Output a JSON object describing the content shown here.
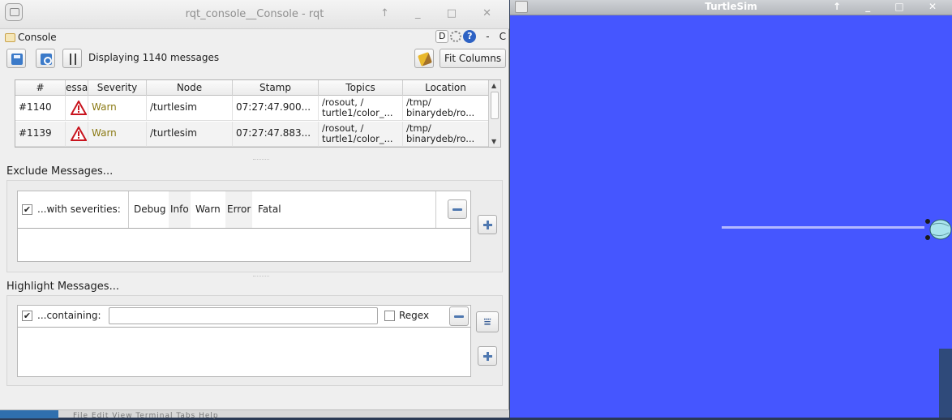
{
  "rqt": {
    "window_title": "rqt_console__Console - rqt",
    "title_buttons": "↑ _ □ ✕",
    "plugin_title": "Console",
    "header": {
      "d_button": "D",
      "dash": "-",
      "o_label": "C"
    },
    "toolbar": {
      "status_text": "Displaying 1140 messages",
      "fit_columns": "Fit Columns"
    },
    "table": {
      "columns": [
        "#",
        "essa",
        "Severity",
        "Node",
        "Stamp",
        "Topics",
        "Location"
      ],
      "rows": [
        {
          "num": "#1140",
          "severity": "Warn",
          "node": "/turtlesim",
          "stamp": "07:27:47.900...",
          "topics_1": "/rosout, /",
          "topics_2": "turtle1/color_...",
          "location_1": "/tmp/",
          "location_2": "binarydeb/ro..."
        },
        {
          "num": "#1139",
          "severity": "Warn",
          "node": "/turtlesim",
          "stamp": "07:27:47.883...",
          "topics_1": "/rosout, /",
          "topics_2": "turtle1/color_...",
          "location_1": "/tmp/",
          "location_2": "binarydeb/ro..."
        }
      ]
    },
    "exclude": {
      "title": "Exclude Messages...",
      "checked_mark": "✔",
      "label": "...with severities:",
      "severities": [
        "Debug",
        "Info",
        "Warn",
        "Error",
        "Fatal"
      ]
    },
    "highlight": {
      "title": "Highlight Messages...",
      "checked_mark": "✔",
      "label": "...containing:",
      "input_value": "",
      "regex_label": "Regex"
    },
    "bottom_menu_ghost": "File   Edit   View   Terminal   Tabs   Help"
  },
  "turtlesim": {
    "window_title": "TurtleSim",
    "title_buttons": "↑ _ □ ✕",
    "background_color": "#4556ff"
  },
  "icons": {
    "app": "rqt-app-icon",
    "plugin": "console-plugin-icon",
    "save": "save-icon",
    "load": "load-icon",
    "pause": "pause-icon",
    "clear": "broom-clear-icon",
    "warn": "warning-triangle-icon",
    "gear": "gear-icon",
    "help": "help-icon",
    "minus": "minus-icon",
    "plus": "plus-icon",
    "highlight": "highlight-filter-icon",
    "turtle": "turtle-icon"
  }
}
